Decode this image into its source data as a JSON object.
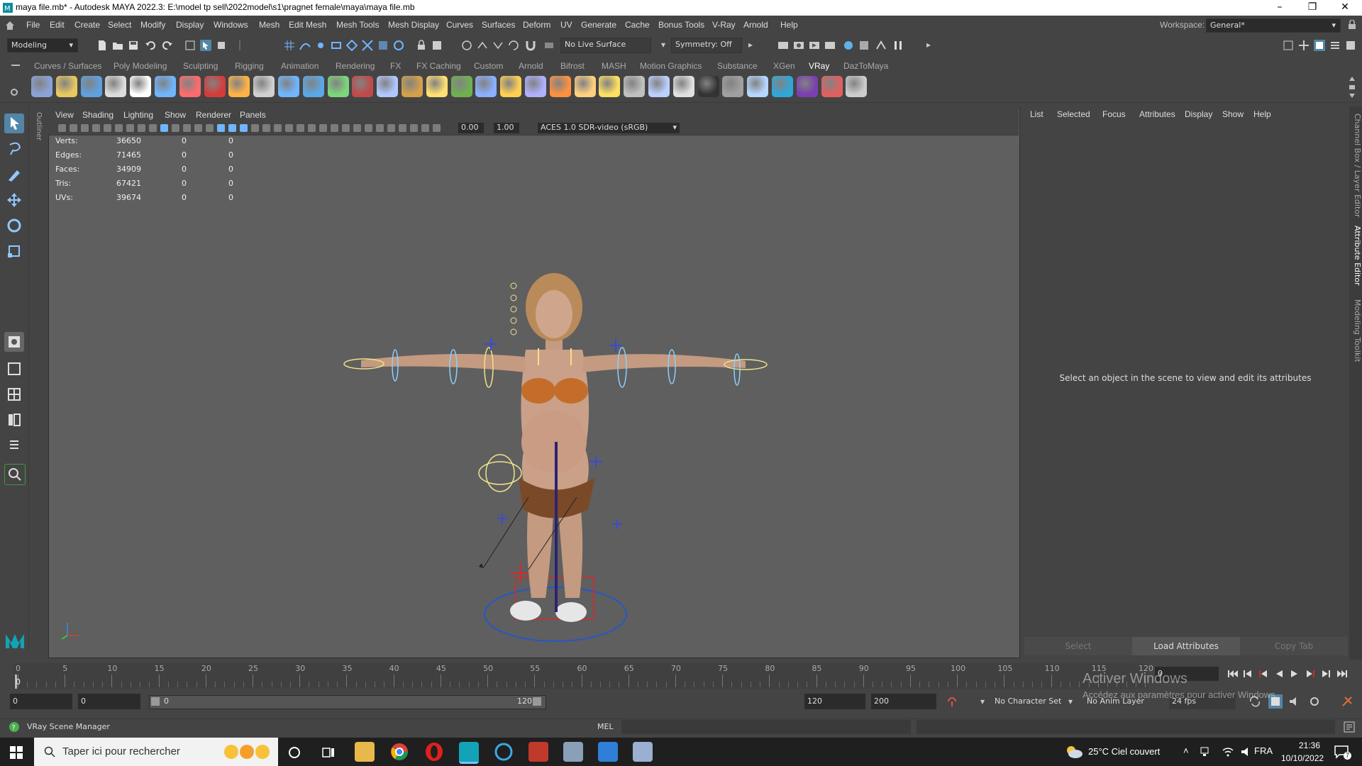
{
  "window": {
    "title": "maya file.mb* - Autodesk MAYA 2022.3: E:\\model tp sell\\2022model\\s1\\pragnet female\\maya\\maya file.mb",
    "min": "–",
    "max": "❐",
    "close": "✕"
  },
  "menubar": {
    "items": [
      "File",
      "Edit",
      "Create",
      "Select",
      "Modify",
      "Display",
      "Windows",
      "Mesh",
      "Edit Mesh",
      "Mesh Tools",
      "Mesh Display",
      "Curves",
      "Surfaces",
      "Deform",
      "UV",
      "Generate",
      "Cache",
      "Bonus Tools",
      "V-Ray",
      "Arnold",
      "Help"
    ],
    "workspace_label": "Workspace:",
    "workspace_value": "General*"
  },
  "statusline": {
    "mode": "Modeling",
    "live_surface": "No Live Surface",
    "symmetry": "Symmetry: Off"
  },
  "shelf": {
    "tabs": [
      "Curves / Surfaces",
      "Poly Modeling",
      "Sculpting",
      "Rigging",
      "Animation",
      "Rendering",
      "FX",
      "FX Caching",
      "Custom",
      "Arnold",
      "Bifrost",
      "MASH",
      "Motion Graphics",
      "Substance",
      "XGen",
      "VRay",
      "DazToMaya"
    ],
    "active_tab": "VRay",
    "icon_colors": [
      "#8aa3d6",
      "#e8c860",
      "#5fa0e0",
      "#dcdcdc",
      "#ffffff",
      "#6fb6ff",
      "#ff6b6b",
      "#d63b3b",
      "#ffb347",
      "#d0d0d0",
      "#6fb6ff",
      "#5ba8e6",
      "#7cd67c",
      "#c04a4a",
      "#b0c8ff",
      "#d4a04a",
      "#ffe070",
      "#70b050",
      "#8ab0ff",
      "#ffd050",
      "#b0b0ff",
      "#ff9040",
      "#ffd080",
      "#ffe060",
      "#c0c0c0",
      "#bcd0ff",
      "#e0e0e0",
      "#333333",
      "#a0a0a0",
      "#b5d6ff",
      "#2fa7d8",
      "#7a3fb0",
      "#e06060",
      "#cccccc"
    ]
  },
  "viewport": {
    "menu": [
      "View",
      "Shading",
      "Lighting",
      "Show",
      "Renderer",
      "Panels"
    ],
    "near_value": "0.00",
    "far_value": "1.00",
    "color_space": "ACES 1.0 SDR-video (sRGB)",
    "stats": [
      {
        "label": "Verts:",
        "v1": "36650",
        "v2": "0",
        "v3": "0"
      },
      {
        "label": "Edges:",
        "v1": "71465",
        "v2": "0",
        "v3": "0"
      },
      {
        "label": "Faces:",
        "v1": "34909",
        "v2": "0",
        "v3": "0"
      },
      {
        "label": "Tris:",
        "v1": "67421",
        "v2": "0",
        "v3": "0"
      },
      {
        "label": "UVs:",
        "v1": "39674",
        "v2": "0",
        "v3": "0"
      }
    ],
    "outliner_tab": "Outliner"
  },
  "attribute_editor": {
    "menu": [
      "List",
      "Selected",
      "Focus",
      "Attributes",
      "Display",
      "Show",
      "Help"
    ],
    "message": "Select an object in the scene to view and edit its attributes",
    "buttons": {
      "select": "Select",
      "load": "Load Attributes",
      "copy": "Copy Tab"
    },
    "side_tabs": [
      "Channel Box / Layer Editor",
      "Attribute Editor",
      "Modeling Toolkit"
    ]
  },
  "timeline": {
    "ticks": [
      "0",
      "5",
      "10",
      "15",
      "20",
      "25",
      "30",
      "35",
      "40",
      "45",
      "50",
      "55",
      "60",
      "65",
      "70",
      "75",
      "80",
      "85",
      "90",
      "95",
      "100",
      "105",
      "110",
      "115",
      "120"
    ],
    "current_frame": "0"
  },
  "range": {
    "start": "0",
    "anim_start": "0",
    "slider_start": "0",
    "slider_end": "120",
    "end": "120",
    "anim_end": "200",
    "character_set": "No Character Set",
    "anim_layer": "No Anim Layer",
    "fps": "24 fps"
  },
  "helpline": {
    "message": "VRay Scene Manager",
    "command_type": "MEL"
  },
  "watermark": {
    "line1": "Activer Windows",
    "line2": "Accédez aux paramètres pour activer Windows."
  },
  "taskbar": {
    "search_placeholder": "Taper ici pour rechercher",
    "weather": "25°C  Ciel couvert",
    "language": "FRA",
    "time": "21:36",
    "date": "10/10/2022",
    "notifications": "7"
  }
}
